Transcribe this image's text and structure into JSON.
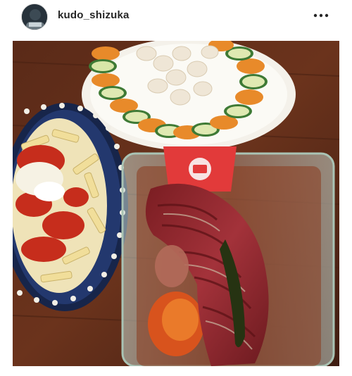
{
  "post": {
    "username": "kudo_shizuka",
    "avatar_icon": "profile-avatar-icon",
    "more_icon": "more-options-icon"
  }
}
